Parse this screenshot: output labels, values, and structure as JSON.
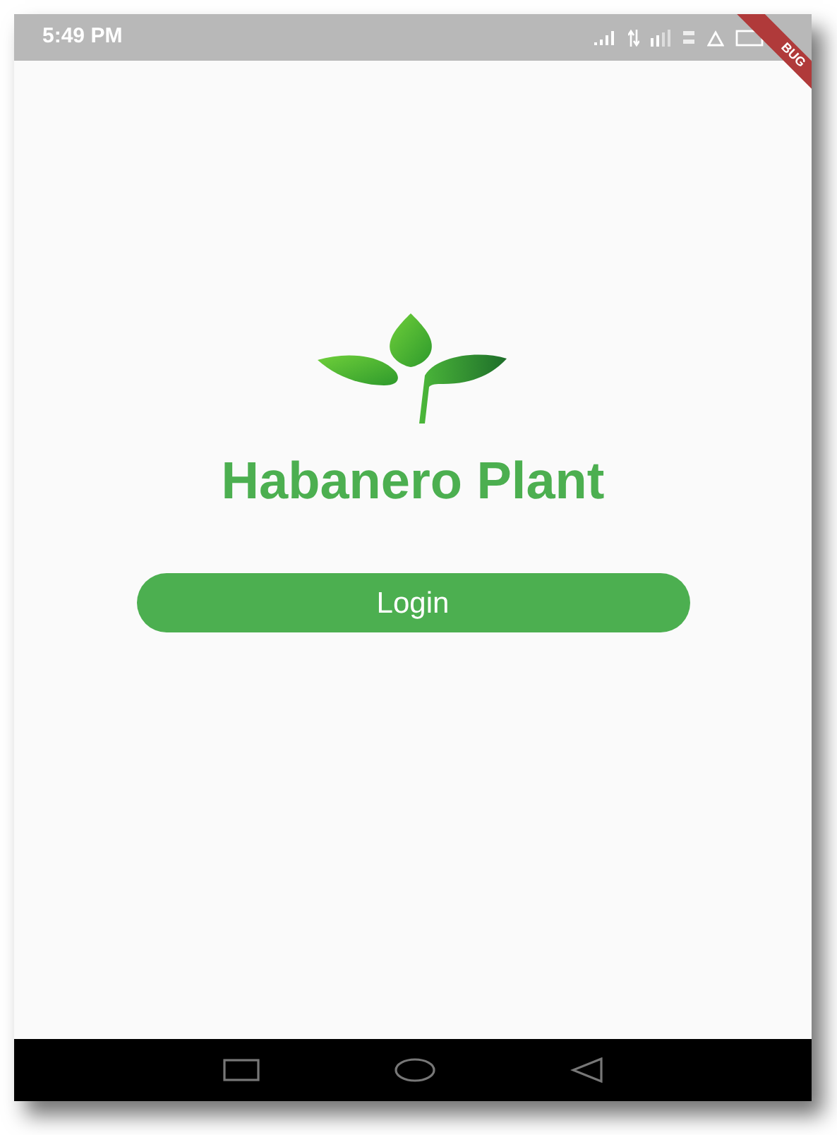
{
  "status_bar": {
    "time": "5:49 PM"
  },
  "debug_banner": {
    "label": "BUG"
  },
  "app": {
    "title": "Habanero Plant",
    "login_button": "Login"
  }
}
